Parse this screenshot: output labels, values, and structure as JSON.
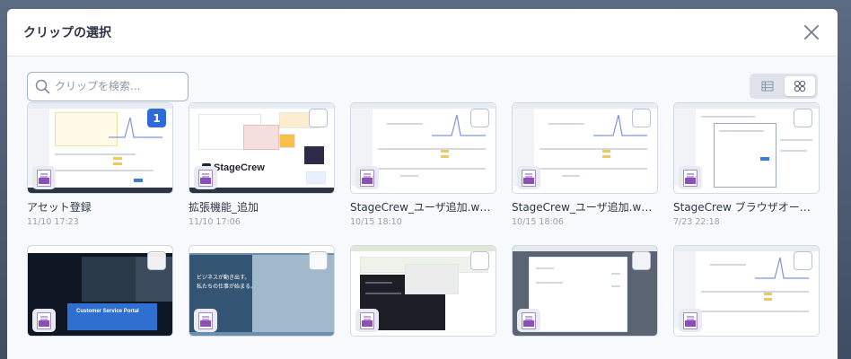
{
  "dialog": {
    "title": "クリップの選択"
  },
  "search": {
    "placeholder": "クリップを検索..."
  },
  "view": {
    "mode": "grid"
  },
  "clips": [
    {
      "name": "アセット登録",
      "date": "11/10 17:23",
      "selected": true,
      "selection_number": "1",
      "thumb": "app-chart"
    },
    {
      "name": "拡張機能_追加",
      "date": "11/10 17:06",
      "selected": false,
      "thumb": "stagecrew"
    },
    {
      "name": "StageCrew_ユーザ追加.webm",
      "date": "10/15 18:10",
      "selected": false,
      "thumb": "app-chart"
    },
    {
      "name": "StageCrew_ユーザ追加.web...",
      "date": "10/15 18:06",
      "selected": false,
      "thumb": "app-chart"
    },
    {
      "name": "StageCrew ブラウザオートメー...",
      "date": "7/23 22:18",
      "selected": false,
      "thumb": "app-modal"
    },
    {
      "name": "",
      "date": "",
      "selected": false,
      "thumb": "dark-site",
      "overlay_text_1": "Customer Service Portal"
    },
    {
      "name": "",
      "date": "",
      "selected": false,
      "thumb": "photo-site",
      "overlay_text_1": "ビジネスが動き出す。",
      "overlay_text_2": "私たちの仕事が始まる。"
    },
    {
      "name": "",
      "date": "",
      "selected": false,
      "thumb": "dark-editor"
    },
    {
      "name": "",
      "date": "",
      "selected": false,
      "thumb": "gray-form"
    },
    {
      "name": "",
      "date": "",
      "selected": false,
      "thumb": "app-chart"
    }
  ],
  "stagecrew_logo_text": "StageCrew",
  "colors": {
    "accent": "#2e6bd6",
    "file_icon": "#8c4fb8"
  },
  "icons": {
    "close": "close-icon",
    "search": "search-icon",
    "list_view": "list-view-icon",
    "grid_view": "grid-view-icon",
    "file_type": "video-file-icon"
  }
}
